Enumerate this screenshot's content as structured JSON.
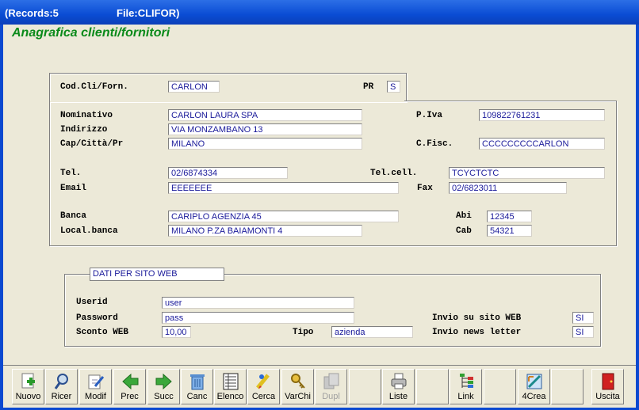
{
  "titlebar": {
    "records": "(Records:5",
    "file": "File:CLIFOR)"
  },
  "heading": "Anagrafica clienti/fornitori",
  "top": {
    "codcli_label": "Cod.Cli/Forn.",
    "codcli_value": "CARLON",
    "pr_label": "PR",
    "pr_value": "S"
  },
  "main": {
    "nominativo_label": "Nominativo",
    "nominativo_value": "CARLON LAURA SPA",
    "indirizzo_label": "Indirizzo",
    "indirizzo_value": "VIA MONZAMBANO 13",
    "cap_label": "Cap/Città/Pr",
    "cap_value": "MILANO",
    "piva_label": "P.Iva",
    "piva_value": "109822761231",
    "cfisc_label": "C.Fisc.",
    "cfisc_value": "CCCCCCCCCARLON",
    "tel_label": "Tel.",
    "tel_value": "02/6874334",
    "telcell_label": "Tel.cell.",
    "telcell_value": "TCYCTCTC",
    "email_label": "Email",
    "email_value": "EEEEEEE",
    "fax_label": "Fax",
    "fax_value": "02/6823011",
    "banca_label": "Banca",
    "banca_value": "CARIPLO AGENZIA 45",
    "abi_label": "Abi",
    "abi_value": "12345",
    "localbanca_label": "Local.banca",
    "localbanca_value": "MILANO P.ZA BAIAMONTI 4",
    "cab_label": "Cab",
    "cab_value": "54321"
  },
  "web": {
    "legend": "DATI PER SITO WEB",
    "userid_label": "Userid",
    "userid_value": "user",
    "password_label": "Password",
    "password_value": "pass",
    "sconto_label": "Sconto WEB",
    "sconto_value": "10,00",
    "tipo_label": "Tipo",
    "tipo_value": "azienda",
    "invio_sito_label": "Invio su sito WEB",
    "invio_sito_value": "SI",
    "invio_news_label": "Invio news letter",
    "invio_news_value": "SI"
  },
  "toolbar": {
    "nuovo": "Nuovo",
    "ricer": "Ricer",
    "modif": "Modif",
    "prec": "Prec",
    "succ": "Succ",
    "canc": "Canc",
    "elenco": "Elenco",
    "cerca": "Cerca",
    "varchi": "VarChi",
    "dupl": "Dupl",
    "liste": "Liste",
    "link": "Link",
    "crea": "4Crea",
    "uscita": "Uscita"
  },
  "colors": {
    "accent_green": "#0A8A1A",
    "field_text": "#1a1a9a",
    "titlebar": "#0A4CD4"
  }
}
